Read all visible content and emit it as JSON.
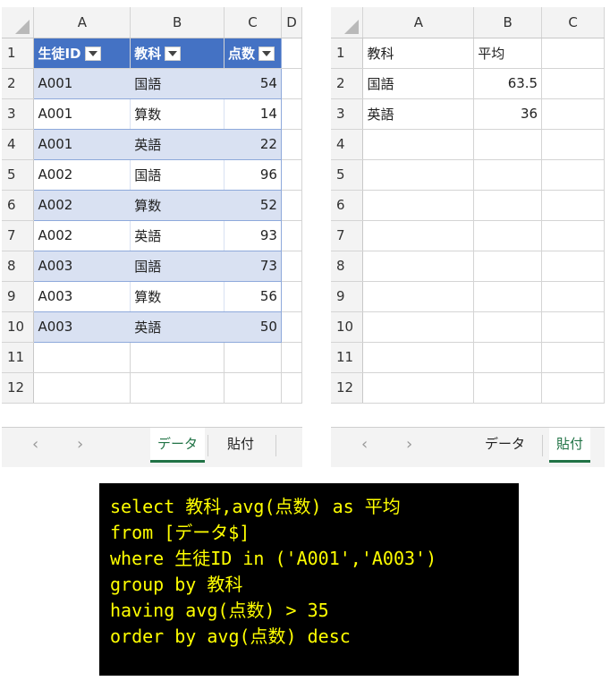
{
  "left_sheet": {
    "col_headers": [
      "A",
      "B",
      "C",
      "D"
    ],
    "row_numbers": [
      "1",
      "2",
      "3",
      "4",
      "5",
      "6",
      "7",
      "8",
      "9",
      "10",
      "11",
      "12"
    ],
    "table_headers": [
      "生徒ID",
      "教科",
      "点数"
    ],
    "rows": [
      [
        "A001",
        "国語",
        "54"
      ],
      [
        "A001",
        "算数",
        "14"
      ],
      [
        "A001",
        "英語",
        "22"
      ],
      [
        "A002",
        "国語",
        "96"
      ],
      [
        "A002",
        "算数",
        "52"
      ],
      [
        "A002",
        "英語",
        "93"
      ],
      [
        "A003",
        "国語",
        "73"
      ],
      [
        "A003",
        "算数",
        "56"
      ],
      [
        "A003",
        "英語",
        "50"
      ]
    ],
    "tabs": [
      "データ",
      "貼付"
    ],
    "active_tab": "データ"
  },
  "right_sheet": {
    "col_headers": [
      "A",
      "B",
      "C"
    ],
    "row_numbers": [
      "1",
      "2",
      "3",
      "4",
      "5",
      "6",
      "7",
      "8",
      "9",
      "10",
      "11",
      "12"
    ],
    "rows": [
      [
        "教科",
        "平均"
      ],
      [
        "国語",
        "63.5"
      ],
      [
        "英語",
        "36"
      ]
    ],
    "tabs": [
      "データ",
      "貼付"
    ],
    "active_tab": "貼付"
  },
  "sql": {
    "lines": [
      "select 教科,avg(点数) as 平均",
      "from [データ$]",
      "where 生徒ID in ('A001','A003')",
      "group by 教科",
      "having avg(点数) > 35",
      "order by avg(点数) desc"
    ]
  },
  "colors": {
    "table_header": "#4472c4",
    "table_band": "#d9e1f2",
    "tab_accent": "#217346",
    "code_bg": "#000000",
    "code_text": "#ffff00"
  },
  "icons": {
    "prev_sheet": "chevron-left-icon",
    "next_sheet": "chevron-right-icon"
  }
}
